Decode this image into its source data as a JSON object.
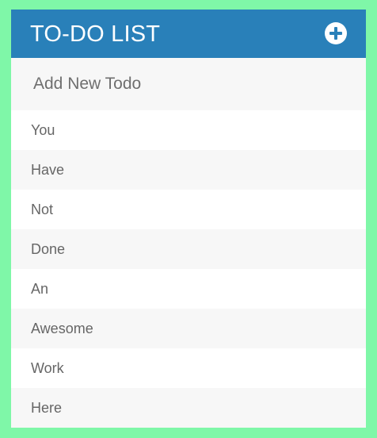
{
  "header": {
    "title": "TO-DO LIST",
    "add_icon": "plus-circle-icon"
  },
  "new_todo": {
    "placeholder": "Add New Todo",
    "value": ""
  },
  "todos": [
    "You",
    "Have",
    "Not",
    "Done",
    "An",
    "Awesome",
    "Work",
    "Here"
  ],
  "colors": {
    "background": "#7ff7a8",
    "header": "#2980b9",
    "text": "#666666",
    "row_alt": "#f7f7f7"
  }
}
